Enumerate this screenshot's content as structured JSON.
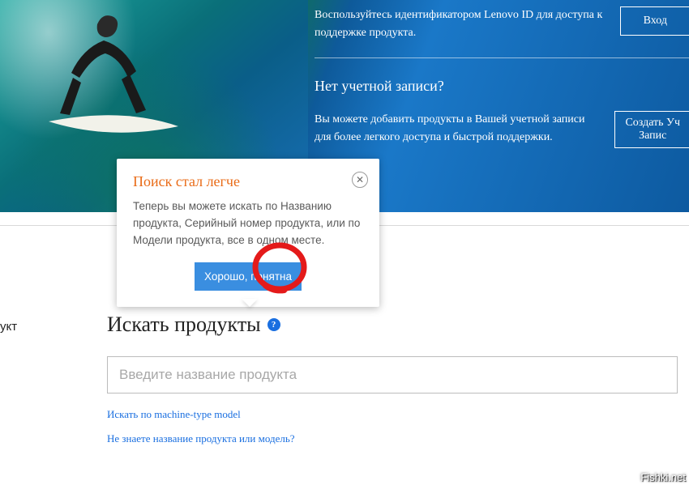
{
  "hero": {
    "line1": "Воспользуйтесь идентификатором Lenovo ID для доступа к поддержке продукта.",
    "login_btn": "Вход",
    "no_account_heading": "Нет учетной записи?",
    "line2": "Вы можете добавить продукты в Вашей учетной записи для более легкого доступа и быстрой поддержки.",
    "create_btn_l1": "Создать Уч",
    "create_btn_l2": "Запис"
  },
  "aside": {
    "text": "укт"
  },
  "tooltip": {
    "title": "Поиск стал легче",
    "body": "Теперь вы можете искать по Названию продукта, Серийный номер продукта, или по Модели продукта, все в одном месте.",
    "btn": "Хорошо, понятна"
  },
  "search": {
    "heading": "Искать продукты",
    "placeholder": "Введите название продукта",
    "link_machine": "Искать по machine-type model",
    "link_unknown": "Не знаете название продукта или модель?"
  },
  "watermark": "Fishki.net"
}
